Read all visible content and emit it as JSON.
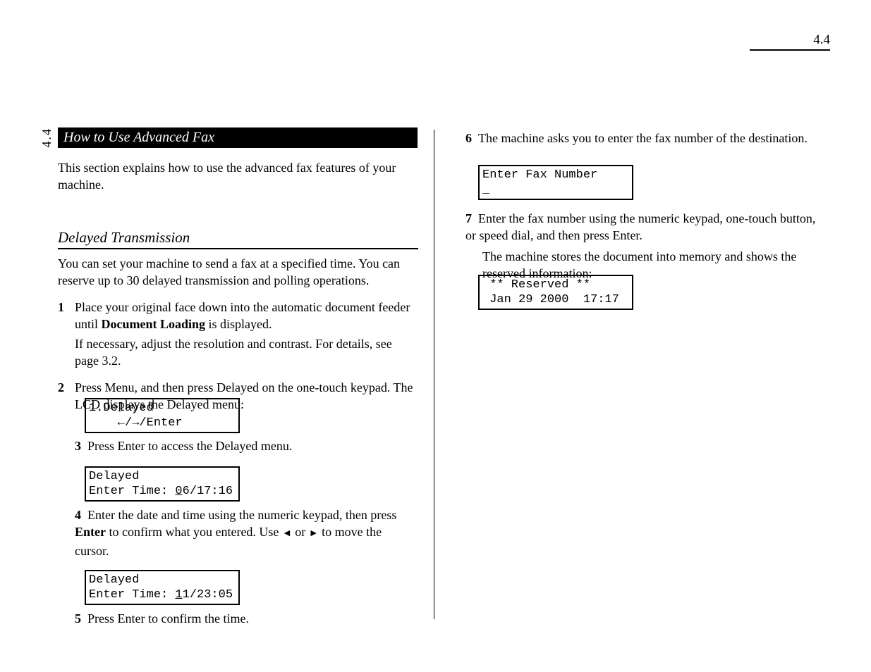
{
  "page_number": "4.4",
  "chapter_sidebar": "4.4",
  "header_title": "How to Use Advanced Fax",
  "intro_text": "This section explains how to use the advanced fax features of your machine.",
  "section_title": "Delayed Transmission",
  "section_para": "You can set your machine to send a fax at a specified time. You can reserve up to 30 delayed transmission and polling operations.",
  "steps": {
    "s1_num": "1",
    "s1_text_a": "Place your original face down into the automatic document feeder until ",
    "s1_text_b": "Document Loading",
    "s1_text_c": " is displayed.",
    "s1_sub": "If necessary, adjust the resolution and contrast. For details, see page 3.2.",
    "s2_num": "2",
    "s2_text": "Press Menu, and then press Delayed on the one-touch keypad. The LCD displays the Delayed menu:",
    "lcd1_line1": "1.Delayed",
    "lcd1_line2": "    ←/→/Enter",
    "s3_num": "3",
    "s3_text": "Press Enter to access the Delayed menu.",
    "lcd2_line1": "Delayed",
    "lcd2_line2_label": "Enter Time: ",
    "lcd2_line2_cursor": "0",
    "lcd2_line2_rest": "6/17:16",
    "s4_num": "4",
    "s4_text_a": "Enter the date and time using the numeric keypad, then press ",
    "s4_text_b": "Enter",
    "s4_text_c": " to confirm what you entered. Use ",
    "s4_text_d": " or ",
    "s4_text_e": " to move the cursor.",
    "lcd3_line1": "Delayed",
    "lcd3_line2_label": "Enter Time: ",
    "lcd3_line2_cursor": "1",
    "lcd3_line2_rest": "1/23:05",
    "s5_num": "5",
    "s5_text": "Press Enter to confirm the time."
  },
  "right": {
    "r1_num": "6",
    "r1_text": "The machine asks you to enter the fax number of the destination.",
    "lcdr1_line1": "Enter Fax Number",
    "lcdr1_line2": "_",
    "r2_num": "7",
    "r2_text": "Enter the fax number using the numeric keypad, one-touch button, or speed dial, and then press Enter.",
    "r3_text": "The machine stores the document into memory and shows the reserved information:",
    "lcdr2_line1": " ** Reserved **",
    "lcdr2_line2": " Jan 29 2000  17:17"
  },
  "arrows": {
    "left": "◄",
    "right": "►"
  }
}
